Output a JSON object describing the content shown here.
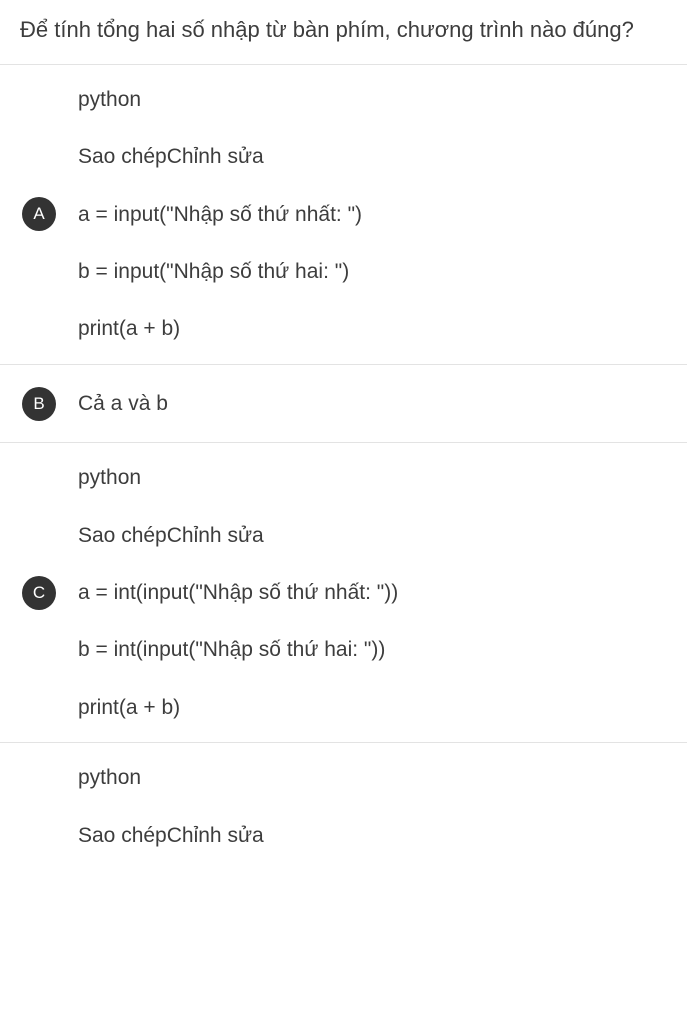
{
  "question": "Để tính tổng hai số nhập từ bàn phím, chương trình nào đúng?",
  "options": {
    "A": {
      "letter": "A",
      "lines": [
        "python",
        "Sao chépChỉnh sửa",
        "a = input(\"Nhập số thứ nhất: \")",
        "b = input(\"Nhập số thứ hai: \")",
        "print(a + b)"
      ]
    },
    "B": {
      "letter": "B",
      "text": "Cả a và b"
    },
    "C": {
      "letter": "C",
      "lines": [
        "python",
        "Sao chépChỉnh sửa",
        "a = int(input(\"Nhập số thứ nhất: \"))",
        "b = int(input(\"Nhập số thứ hai: \"))",
        "print(a + b)"
      ]
    },
    "D": {
      "lines": [
        "python",
        "Sao chépChỉnh sửa"
      ]
    }
  }
}
